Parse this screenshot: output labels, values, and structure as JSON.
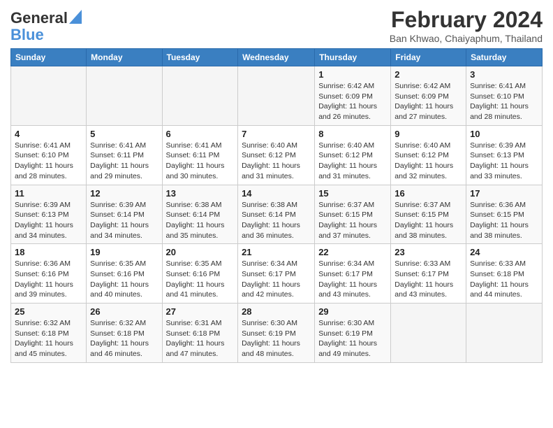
{
  "header": {
    "logo_line1": "General",
    "logo_line2": "Blue",
    "title": "February 2024",
    "subtitle": "Ban Khwao, Chaiyaphum, Thailand"
  },
  "weekdays": [
    "Sunday",
    "Monday",
    "Tuesday",
    "Wednesday",
    "Thursday",
    "Friday",
    "Saturday"
  ],
  "weeks": [
    [
      {
        "day": "",
        "info": ""
      },
      {
        "day": "",
        "info": ""
      },
      {
        "day": "",
        "info": ""
      },
      {
        "day": "",
        "info": ""
      },
      {
        "day": "1",
        "info": "Sunrise: 6:42 AM\nSunset: 6:09 PM\nDaylight: 11 hours and 26 minutes."
      },
      {
        "day": "2",
        "info": "Sunrise: 6:42 AM\nSunset: 6:09 PM\nDaylight: 11 hours and 27 minutes."
      },
      {
        "day": "3",
        "info": "Sunrise: 6:41 AM\nSunset: 6:10 PM\nDaylight: 11 hours and 28 minutes."
      }
    ],
    [
      {
        "day": "4",
        "info": "Sunrise: 6:41 AM\nSunset: 6:10 PM\nDaylight: 11 hours and 28 minutes."
      },
      {
        "day": "5",
        "info": "Sunrise: 6:41 AM\nSunset: 6:11 PM\nDaylight: 11 hours and 29 minutes."
      },
      {
        "day": "6",
        "info": "Sunrise: 6:41 AM\nSunset: 6:11 PM\nDaylight: 11 hours and 30 minutes."
      },
      {
        "day": "7",
        "info": "Sunrise: 6:40 AM\nSunset: 6:12 PM\nDaylight: 11 hours and 31 minutes."
      },
      {
        "day": "8",
        "info": "Sunrise: 6:40 AM\nSunset: 6:12 PM\nDaylight: 11 hours and 31 minutes."
      },
      {
        "day": "9",
        "info": "Sunrise: 6:40 AM\nSunset: 6:12 PM\nDaylight: 11 hours and 32 minutes."
      },
      {
        "day": "10",
        "info": "Sunrise: 6:39 AM\nSunset: 6:13 PM\nDaylight: 11 hours and 33 minutes."
      }
    ],
    [
      {
        "day": "11",
        "info": "Sunrise: 6:39 AM\nSunset: 6:13 PM\nDaylight: 11 hours and 34 minutes."
      },
      {
        "day": "12",
        "info": "Sunrise: 6:39 AM\nSunset: 6:14 PM\nDaylight: 11 hours and 34 minutes."
      },
      {
        "day": "13",
        "info": "Sunrise: 6:38 AM\nSunset: 6:14 PM\nDaylight: 11 hours and 35 minutes."
      },
      {
        "day": "14",
        "info": "Sunrise: 6:38 AM\nSunset: 6:14 PM\nDaylight: 11 hours and 36 minutes."
      },
      {
        "day": "15",
        "info": "Sunrise: 6:37 AM\nSunset: 6:15 PM\nDaylight: 11 hours and 37 minutes."
      },
      {
        "day": "16",
        "info": "Sunrise: 6:37 AM\nSunset: 6:15 PM\nDaylight: 11 hours and 38 minutes."
      },
      {
        "day": "17",
        "info": "Sunrise: 6:36 AM\nSunset: 6:15 PM\nDaylight: 11 hours and 38 minutes."
      }
    ],
    [
      {
        "day": "18",
        "info": "Sunrise: 6:36 AM\nSunset: 6:16 PM\nDaylight: 11 hours and 39 minutes."
      },
      {
        "day": "19",
        "info": "Sunrise: 6:35 AM\nSunset: 6:16 PM\nDaylight: 11 hours and 40 minutes."
      },
      {
        "day": "20",
        "info": "Sunrise: 6:35 AM\nSunset: 6:16 PM\nDaylight: 11 hours and 41 minutes."
      },
      {
        "day": "21",
        "info": "Sunrise: 6:34 AM\nSunset: 6:17 PM\nDaylight: 11 hours and 42 minutes."
      },
      {
        "day": "22",
        "info": "Sunrise: 6:34 AM\nSunset: 6:17 PM\nDaylight: 11 hours and 43 minutes."
      },
      {
        "day": "23",
        "info": "Sunrise: 6:33 AM\nSunset: 6:17 PM\nDaylight: 11 hours and 43 minutes."
      },
      {
        "day": "24",
        "info": "Sunrise: 6:33 AM\nSunset: 6:18 PM\nDaylight: 11 hours and 44 minutes."
      }
    ],
    [
      {
        "day": "25",
        "info": "Sunrise: 6:32 AM\nSunset: 6:18 PM\nDaylight: 11 hours and 45 minutes."
      },
      {
        "day": "26",
        "info": "Sunrise: 6:32 AM\nSunset: 6:18 PM\nDaylight: 11 hours and 46 minutes."
      },
      {
        "day": "27",
        "info": "Sunrise: 6:31 AM\nSunset: 6:18 PM\nDaylight: 11 hours and 47 minutes."
      },
      {
        "day": "28",
        "info": "Sunrise: 6:30 AM\nSunset: 6:19 PM\nDaylight: 11 hours and 48 minutes."
      },
      {
        "day": "29",
        "info": "Sunrise: 6:30 AM\nSunset: 6:19 PM\nDaylight: 11 hours and 49 minutes."
      },
      {
        "day": "",
        "info": ""
      },
      {
        "day": "",
        "info": ""
      }
    ]
  ]
}
